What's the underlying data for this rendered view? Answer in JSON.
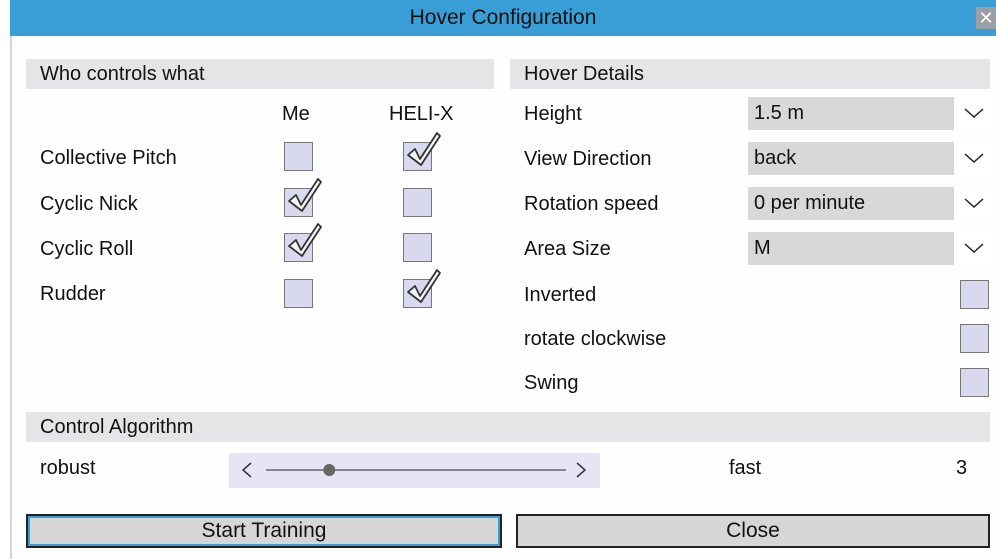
{
  "window": {
    "title": "Hover Configuration",
    "close_label": "✕"
  },
  "who_controls": {
    "header": "Who controls what",
    "col_me": "Me",
    "col_helix": "HELI-X",
    "rows": [
      {
        "label": "Collective Pitch",
        "me": false,
        "helix": true
      },
      {
        "label": "Cyclic Nick",
        "me": true,
        "helix": false
      },
      {
        "label": "Cyclic Roll",
        "me": true,
        "helix": false
      },
      {
        "label": "Rudder",
        "me": false,
        "helix": true
      }
    ]
  },
  "hover_details": {
    "header": "Hover Details",
    "height": {
      "label": "Height",
      "value": "1.5 m"
    },
    "view_direction": {
      "label": "View Direction",
      "value": "back"
    },
    "rotation_speed": {
      "label": "Rotation speed",
      "value": "0 per minute"
    },
    "area_size": {
      "label": "Area Size",
      "value": "M"
    },
    "inverted": {
      "label": "Inverted",
      "checked": false
    },
    "rotate_clockwise": {
      "label": "rotate clockwise",
      "checked": false
    },
    "swing": {
      "label": "Swing",
      "checked": false
    }
  },
  "control_algorithm": {
    "header": "Control Algorithm",
    "left_label": "robust",
    "right_label": "fast",
    "value": "3",
    "slider_min": 1,
    "slider_max": 10,
    "slider_value": 3
  },
  "buttons": {
    "start": "Start Training",
    "close": "Close"
  },
  "colors": {
    "titlebar": "#3a9ed6",
    "checkbox_fill": "#d8d8ee",
    "section_header": "#e5e5e8"
  }
}
